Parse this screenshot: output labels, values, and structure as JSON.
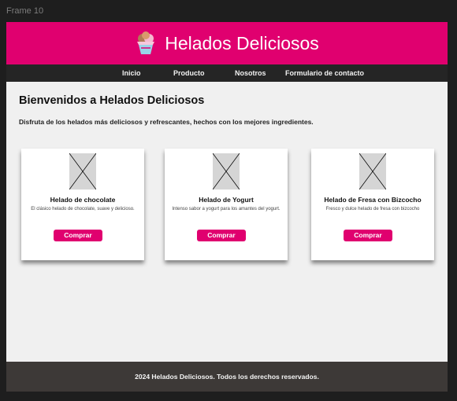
{
  "canvas": {
    "frame_label": "Frame 10"
  },
  "header": {
    "title": "Helados Deliciosos",
    "logo_icon": "ice-cream-cup-icon"
  },
  "nav": {
    "items": [
      "Inicio",
      "Producto",
      "Nosotros",
      "Formulario de contacto"
    ]
  },
  "welcome": {
    "title": "Bienvenidos a Helados Deliciosos",
    "text": "Disfruta de los helados más deliciosos y refrescantes, hechos con los mejores ingredientes."
  },
  "products": [
    {
      "title": "Helado de chocolate",
      "desc": "El clásico helado de chocolate, suave y delicioso.",
      "button": "Comprar"
    },
    {
      "title": "Helado de Yogurt",
      "desc": "Intenso sabor a yogurt para los amantes del yogurt.",
      "button": "Comprar"
    },
    {
      "title": "Helado de Fresa con Bizcocho",
      "desc": "Fresco y dulce helado de fresa con bizcocho",
      "button": "Comprar"
    }
  ],
  "footer": {
    "text": "2024 Helados Deliciosos. Todos los derechos reservados."
  },
  "colors": {
    "brand": "#e0006f",
    "nav_bg": "#252525",
    "footer_bg": "#3d3937",
    "page_bg": "#f0f0f0"
  }
}
